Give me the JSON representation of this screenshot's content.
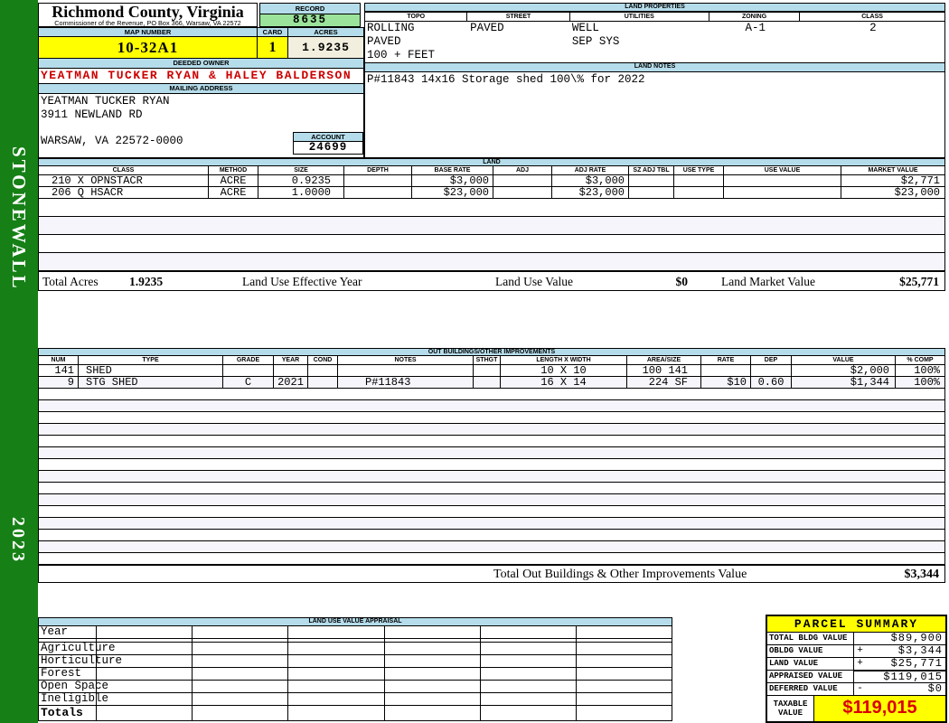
{
  "colors": {
    "sidebar_green": "#168016",
    "header_blue": "#b5dcea",
    "highlight_yellow": "#ffff00",
    "record_green": "#9be39b",
    "acres_ivory": "#f2efdf",
    "owner_red": "#cc0000",
    "taxable_red": "#d90000"
  },
  "sidebar": {
    "district": "STONEWALL",
    "year": "2023"
  },
  "header": {
    "county": "Richmond County, Virginia",
    "commissioner": "Commissioner of the Revenue, PO Box 366, Warsaw, VA 22572"
  },
  "record": {
    "label": "RECORD",
    "value": "8635"
  },
  "map_number": {
    "label": "MAP NUMBER",
    "value": "10-32A1"
  },
  "card": {
    "label": "CARD",
    "value": "1"
  },
  "acres": {
    "label": "ACRES",
    "value": "1.9235"
  },
  "deeded_owner": {
    "label": "DEEDED OWNER",
    "value": "YEATMAN TUCKER RYAN & HALEY BALDERSON"
  },
  "mailing": {
    "label": "MAILING ADDRESS",
    "line1": "YEATMAN TUCKER RYAN",
    "line2": "3911 NEWLAND RD",
    "line3": "WARSAW, VA 22572-0000"
  },
  "account": {
    "label": "ACCOUNT",
    "value": "24699"
  },
  "land_properties": {
    "title": "LAND PROPERTIES",
    "headers": [
      "TOPO",
      "STREET",
      "UTILITIES",
      "ZONING",
      "CLASS"
    ],
    "topo": [
      "ROLLING",
      "PAVED",
      "100 + FEET"
    ],
    "street": "PAVED",
    "utilities": [
      "WELL",
      "SEP SYS"
    ],
    "zoning": "A-1",
    "class": "2"
  },
  "land_notes": {
    "title": "LAND NOTES",
    "note": "P#11843 14x16 Storage shed 100\\% for 2022"
  },
  "land": {
    "title": "LAND",
    "headers": [
      "CLASS",
      "METHOD",
      "SIZE",
      "DEPTH",
      "BASE RATE",
      "ADJ",
      "ADJ RATE",
      "SZ ADJ TBL",
      "USE TYPE",
      "USE VALUE",
      "MARKET VALUE"
    ],
    "rows": [
      {
        "class": "210 X OPNSTACR",
        "method": "ACRE",
        "size": "0.9235",
        "depth": "",
        "base_rate": "$3,000",
        "adj": "",
        "adj_rate": "$3,000",
        "sz_adj_tbl": "",
        "use_type": "",
        "use_value": "",
        "market_value": "$2,771"
      },
      {
        "class": "206 Q HSACR",
        "method": "ACRE",
        "size": "1.0000",
        "depth": "",
        "base_rate": "$23,000",
        "adj": "",
        "adj_rate": "$23,000",
        "sz_adj_tbl": "",
        "use_type": "",
        "use_value": "",
        "market_value": "$23,000"
      }
    ],
    "totals": {
      "total_acres_label": "Total Acres",
      "total_acres": "1.9235",
      "effective_year_label": "Land Use Effective Year",
      "use_value_label": "Land Use Value",
      "use_value": "$0",
      "market_value_label": "Land Market Value",
      "market_value": "$25,771"
    }
  },
  "out_buildings": {
    "title": "OUT BUILDINGS/OTHER IMPROVEMENTS",
    "headers": [
      "NUM",
      "TYPE",
      "GRADE",
      "YEAR",
      "COND",
      "NOTES",
      "STHGT",
      "LENGTH X WIDTH",
      "AREA/SIZE",
      "RATE",
      "DEP",
      "VALUE",
      "% COMP"
    ],
    "rows": [
      {
        "num": "141",
        "type": "SHED",
        "grade": "",
        "year": "",
        "cond": "",
        "notes": "",
        "sthgt": "",
        "length_width": "10 X 10",
        "area_size": "100 141",
        "rate": "",
        "dep": "",
        "value": "$2,000",
        "comp": "100%"
      },
      {
        "num": "9",
        "type": "STG SHED",
        "grade": "C",
        "year": "2021",
        "cond": "",
        "notes": "P#11843",
        "sthgt": "",
        "length_width": "16 X 14",
        "area_size": "224 SF",
        "rate": "$10",
        "dep": "0.60",
        "value": "$1,344",
        "comp": "100%"
      }
    ],
    "total_label": "Total Out Buildings & Other Improvements Value",
    "total_value": "$3,344"
  },
  "land_use_appraisal": {
    "title": "LAND USE VALUE APPRAISAL",
    "row_labels": [
      "Year",
      "Agriculture",
      "Horticulture",
      "Forest",
      "Open Space",
      "Ineligible",
      "Totals"
    ]
  },
  "parcel_summary": {
    "title": "PARCEL SUMMARY",
    "rows": [
      {
        "label": "TOTAL BLDG VALUE",
        "sign": "",
        "value": "$89,900"
      },
      {
        "label": "OBLDG VALUE",
        "sign": "+",
        "value": "$3,344"
      },
      {
        "label": "LAND VALUE",
        "sign": "+",
        "value": "$25,771"
      },
      {
        "label": "APPRAISED VALUE",
        "sign": "",
        "value": "$119,015"
      },
      {
        "label": "DEFERRED VALUE",
        "sign": "-",
        "value": "$0"
      }
    ],
    "taxable": {
      "label": "TAXABLE VALUE",
      "value": "$119,015"
    }
  }
}
